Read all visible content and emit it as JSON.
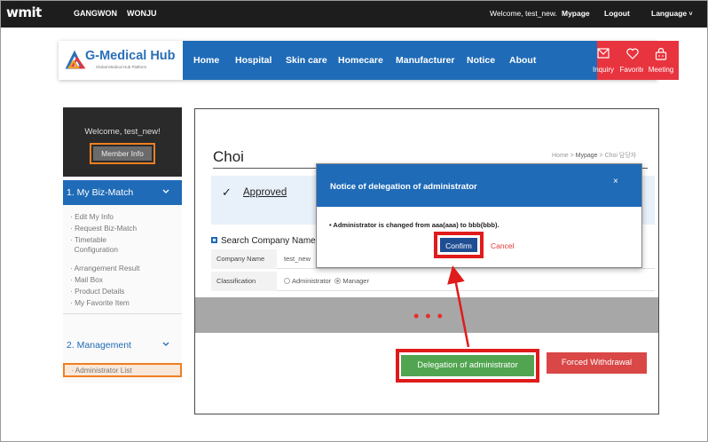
{
  "topbar": {
    "logo": "wmit",
    "region1": "GANGWON",
    "region2": "WONJU",
    "welcome": "Welcome, test_new.",
    "mypage": "Mypage",
    "logout": "Logout",
    "language": "Language"
  },
  "brand": {
    "name": "G-Medical Hub",
    "tagline": "Global Medical Hub Platform"
  },
  "nav": {
    "items": [
      "Home",
      "Hospital",
      "Skin care",
      "Homecare",
      "Manufacturer",
      "Notice",
      "About"
    ],
    "icons": [
      {
        "label": "Inquiry",
        "icon": "mail-icon"
      },
      {
        "label": "Favorite",
        "icon": "heart-icon"
      },
      {
        "label": "Meeting",
        "icon": "meeting-icon"
      }
    ]
  },
  "sidebar": {
    "welcome": "Welcome, test_new!",
    "member_info": "Member Info",
    "section1": "1. My Biz-Match",
    "section1_links": [
      "· Edit My Info",
      "· Request Biz-Match",
      "· Timetable\n  Configuration",
      "· Arrangement Result",
      "· Mail Box",
      "· Product Details",
      "· My Favorite Item"
    ],
    "section2": "2. Management",
    "admin_list": "· Administrator List"
  },
  "main": {
    "title": "Choi",
    "breadcrumb_home": "Home",
    "breadcrumb_mypage": "Mypage",
    "breadcrumb_current": "Choi 담당자",
    "approved": "Approved",
    "search_title": "Search Company Name",
    "company_label": "Company Name",
    "company_value": "test_new",
    "class_label": "Classification",
    "class_opt1": "Administrator",
    "class_opt2": "Manager",
    "dots": "• • •",
    "delegation_button": "Delegation of administrator",
    "forced_button": "Forced Withdrawal"
  },
  "modal": {
    "title": "Notice of delegation of administrator",
    "close": "×",
    "message": "• Administrator is changed from aaa(aaa) to bbb(bbb).",
    "confirm": "Confirm",
    "cancel": "Cancel"
  }
}
